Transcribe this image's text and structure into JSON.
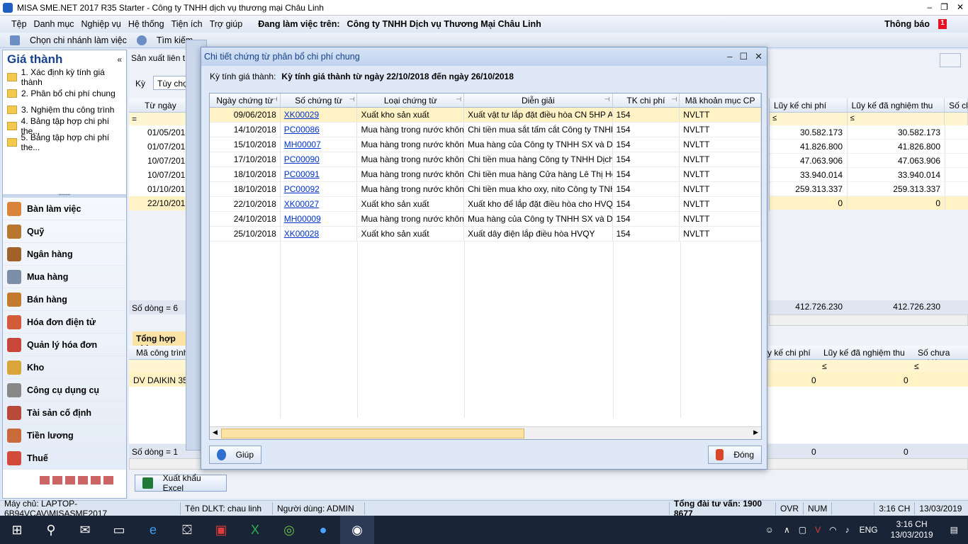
{
  "window": {
    "title": "MISA SME.NET 2017 R35 Starter - Công ty TNHH dịch vụ thương mại Châu Linh"
  },
  "menu": {
    "items": [
      "Tệp",
      "Danh mục",
      "Nghiệp vụ",
      "Hệ thống",
      "Tiện ích",
      "Trợ giúp"
    ],
    "work_label": "Đang làm việc trên:",
    "work_company": "Công ty TNHH Dịch vụ Thương Mại Châu Linh",
    "notification": "Thông báo",
    "notification_count": "1"
  },
  "toolbar": {
    "branch": "Chọn chi nhánh làm việc",
    "search": "Tìm kiếm..."
  },
  "sidebar": {
    "title": "Giá thành",
    "items": [
      "1. Xác định kỳ tính giá thành",
      "2. Phân bổ chi phí chung",
      "3. Nghiệm thu công trình",
      "4. Bảng tập hợp chi phí the...",
      "5. Bảng tập hợp chi phí the..."
    ],
    "modules": [
      "Bàn làm việc",
      "Quỹ",
      "Ngân hàng",
      "Mua hàng",
      "Bán hàng",
      "Hóa đơn điện tử",
      "Quản lý hóa đơn",
      "Kho",
      "Công cụ dụng cụ",
      "Tài sản cố định",
      "Tiền lương",
      "Thuế"
    ]
  },
  "main": {
    "tab": "Sản xuất liên t",
    "ky_label": "Kỳ",
    "ky_value": "Tùy chọ",
    "from_header": "Từ ngày",
    "dates": [
      "01/05/2018",
      "01/07/2018",
      "10/07/2018",
      "10/07/2018",
      "01/10/2018",
      "22/10/2018"
    ],
    "row_count": "Số dòng = 6",
    "headers_right": [
      "Lũy kế chi phí",
      "Lũy kế đã nghiệm thu",
      "Số ch"
    ],
    "rows_right": [
      [
        "30.582.173",
        "30.582.173"
      ],
      [
        "41.826.800",
        "41.826.800"
      ],
      [
        "47.063.906",
        "47.063.906"
      ],
      [
        "33.940.014",
        "33.940.014"
      ],
      [
        "259.313.337",
        "259.313.337"
      ],
      [
        "0",
        "0"
      ]
    ],
    "totals": [
      "412.726.230",
      "412.726.230"
    ],
    "summary_title": "Tổng hợp chi",
    "summary_headers": [
      "Mã công trình",
      "y kế chi phí",
      "Lũy kế đã nghiệm thu",
      "Số chưa nghiệ"
    ],
    "summary_row": [
      "DV DAIKIN 35F",
      "0",
      "0"
    ],
    "summary_count": "Số dòng = 1",
    "summary_totals": [
      "0",
      "0"
    ],
    "export": "Xuất khẩu Excel"
  },
  "dialog": {
    "title": "Chi tiết chứng từ phân bổ chi phí chung",
    "period_label": "Kỳ tính giá thành:",
    "period_value": "Kỳ tính giá thành từ ngày 22/10/2018 đến ngày 26/10/2018",
    "headers": [
      "Ngày chứng từ",
      "Số chứng từ",
      "Loại chứng từ",
      "Diễn giải",
      "TK chi phí",
      "Mã khoản mục CP"
    ],
    "rows": [
      [
        "09/06/2018",
        "XK00029",
        "Xuất kho sản xuất",
        "Xuất vật tư lắp đặt điều hòa CN 5HP Alp",
        "154",
        "NVLTT"
      ],
      [
        "14/10/2018",
        "PC00086",
        "Mua hàng trong nước không",
        "Chi tiền mua sắt tấm cắt  Công ty TNHH",
        "154",
        "NVLTT"
      ],
      [
        "15/10/2018",
        "MH00007",
        "Mua hàng trong nước không",
        "Mua hàng của Công ty TNHH SX và DV",
        "154",
        "NVLTT"
      ],
      [
        "17/10/2018",
        "PC00090",
        "Mua hàng trong nước không",
        "Chi tiền mua hàng Công ty TNHH Dịch",
        "154",
        "NVLTT"
      ],
      [
        "18/10/2018",
        "PC00091",
        "Mua hàng trong nước không",
        "Chi tiền mua hàng Cửa hàng Lê Thị Ho",
        "154",
        "NVLTT"
      ],
      [
        "18/10/2018",
        "PC00092",
        "Mua hàng trong nước không",
        "Chi tiền mua kho oxy, nito Công ty TNH",
        "154",
        "NVLTT"
      ],
      [
        "22/10/2018",
        "XK00027",
        "Xuất kho sản xuất",
        "Xuất kho để lắp đặt điều hòa cho HVQY",
        "154",
        "NVLTT"
      ],
      [
        "24/10/2018",
        "MH00009",
        "Mua hàng trong nước không",
        "Mua hàng của Công ty TNHH SX và DV",
        "154",
        "NVLTT"
      ],
      [
        "25/10/2018",
        "XK00028",
        "Xuất kho sản xuất",
        "Xuất dây điện lắp điều hòa HVQY",
        "154",
        "NVLTT"
      ]
    ],
    "help": "Giúp",
    "close": "Đóng"
  },
  "statusbar": {
    "server": "Máy chủ: LAPTOP-6B94VCAV\\MISASME2017",
    "db": "Tên DLKT: chau linh",
    "user": "Người dùng: ADMIN",
    "hotline": "Tổng đài tư vấn: 1900 8677",
    "ovr": "OVR",
    "num": "NUM",
    "time": "3:16 CH",
    "date": "13/03/2019"
  },
  "taskbar": {
    "lang": "ENG",
    "time": "3:16 CH",
    "date": "13/03/2019"
  }
}
